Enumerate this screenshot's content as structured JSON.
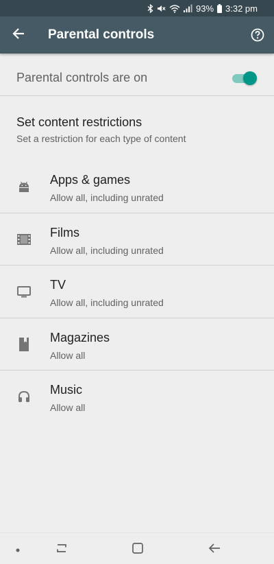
{
  "status_bar": {
    "battery": "93%",
    "time": "3:32 pm",
    "icons": [
      "bluetooth-icon",
      "mute-icon",
      "wifi-icon",
      "signal-icon",
      "battery-icon"
    ]
  },
  "app_bar": {
    "title": "Parental controls",
    "back_icon": "arrow-back-icon",
    "help_icon": "help-circle-icon"
  },
  "master": {
    "label": "Parental controls are on",
    "toggle_on": true,
    "accent": "#009688"
  },
  "section": {
    "title": "Set content restrictions",
    "subtitle": "Set a restriction for each type of content"
  },
  "items": [
    {
      "icon": "android-icon",
      "title": "Apps & games",
      "subtitle": "Allow all, including unrated"
    },
    {
      "icon": "film-icon",
      "title": "Films",
      "subtitle": "Allow all, including unrated"
    },
    {
      "icon": "tv-icon",
      "title": "TV",
      "subtitle": "Allow all, including unrated"
    },
    {
      "icon": "magazine-icon",
      "title": "Magazines",
      "subtitle": "Allow all"
    },
    {
      "icon": "headphones-icon",
      "title": "Music",
      "subtitle": "Allow all"
    }
  ],
  "nav_bar": {
    "icons": [
      "dot-icon",
      "recents-icon",
      "home-icon",
      "back-icon"
    ]
  },
  "colors": {
    "status_bar": "#37474f",
    "app_bar": "#455a64",
    "background": "#eeeeee"
  }
}
